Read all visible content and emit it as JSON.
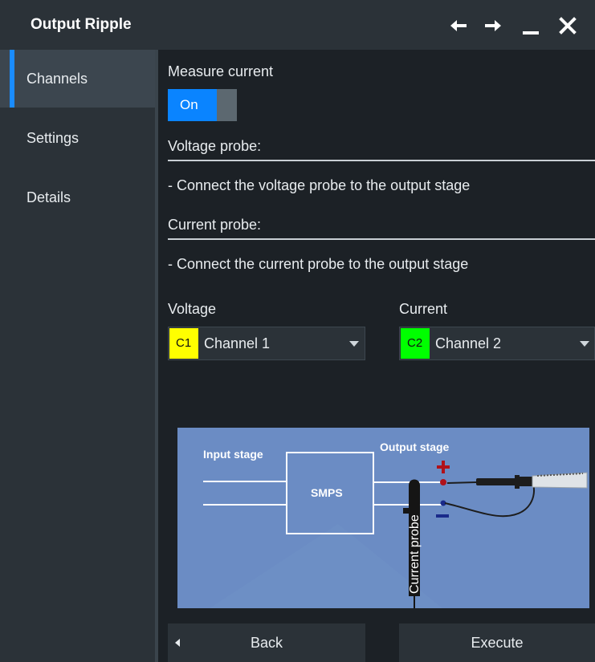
{
  "window": {
    "title": "Output Ripple",
    "controls": [
      "back-arrow-icon",
      "forward-arrow-icon",
      "minimize-icon",
      "close-icon"
    ]
  },
  "sidebar": {
    "items": [
      {
        "label": "Channels",
        "active": true
      },
      {
        "label": "Settings",
        "active": false
      },
      {
        "label": "Details",
        "active": false
      }
    ]
  },
  "channels": {
    "measure_current_label": "Measure current",
    "measure_current_toggle": "On",
    "voltage_probe_heading": "Voltage probe:",
    "voltage_probe_text": "- Connect the voltage probe to the output stage",
    "current_probe_heading": "Current probe:",
    "current_probe_text": "- Connect the current probe to the output stage",
    "voltage_label": "Voltage",
    "current_label": "Current",
    "voltage_select": {
      "badge": "C1",
      "value": "Channel 1",
      "badge_color": "#ffff00"
    },
    "current_select": {
      "badge": "C2",
      "value": "Channel 2",
      "badge_color": "#00ff00"
    }
  },
  "diagram": {
    "input_stage": "Input stage",
    "output_stage": "Output stage",
    "smps": "SMPS",
    "current_probe": "Current probe",
    "plus": "+",
    "minus": "−"
  },
  "footer": {
    "back_label": "Back",
    "execute_label": "Execute"
  },
  "colors": {
    "accent": "#0a84ff",
    "background": "#1c2126",
    "panel": "#2b3238",
    "diagram_bg": "#6b8cc4",
    "probe_red": "#b0111a",
    "probe_blue": "#1a2a8a"
  }
}
